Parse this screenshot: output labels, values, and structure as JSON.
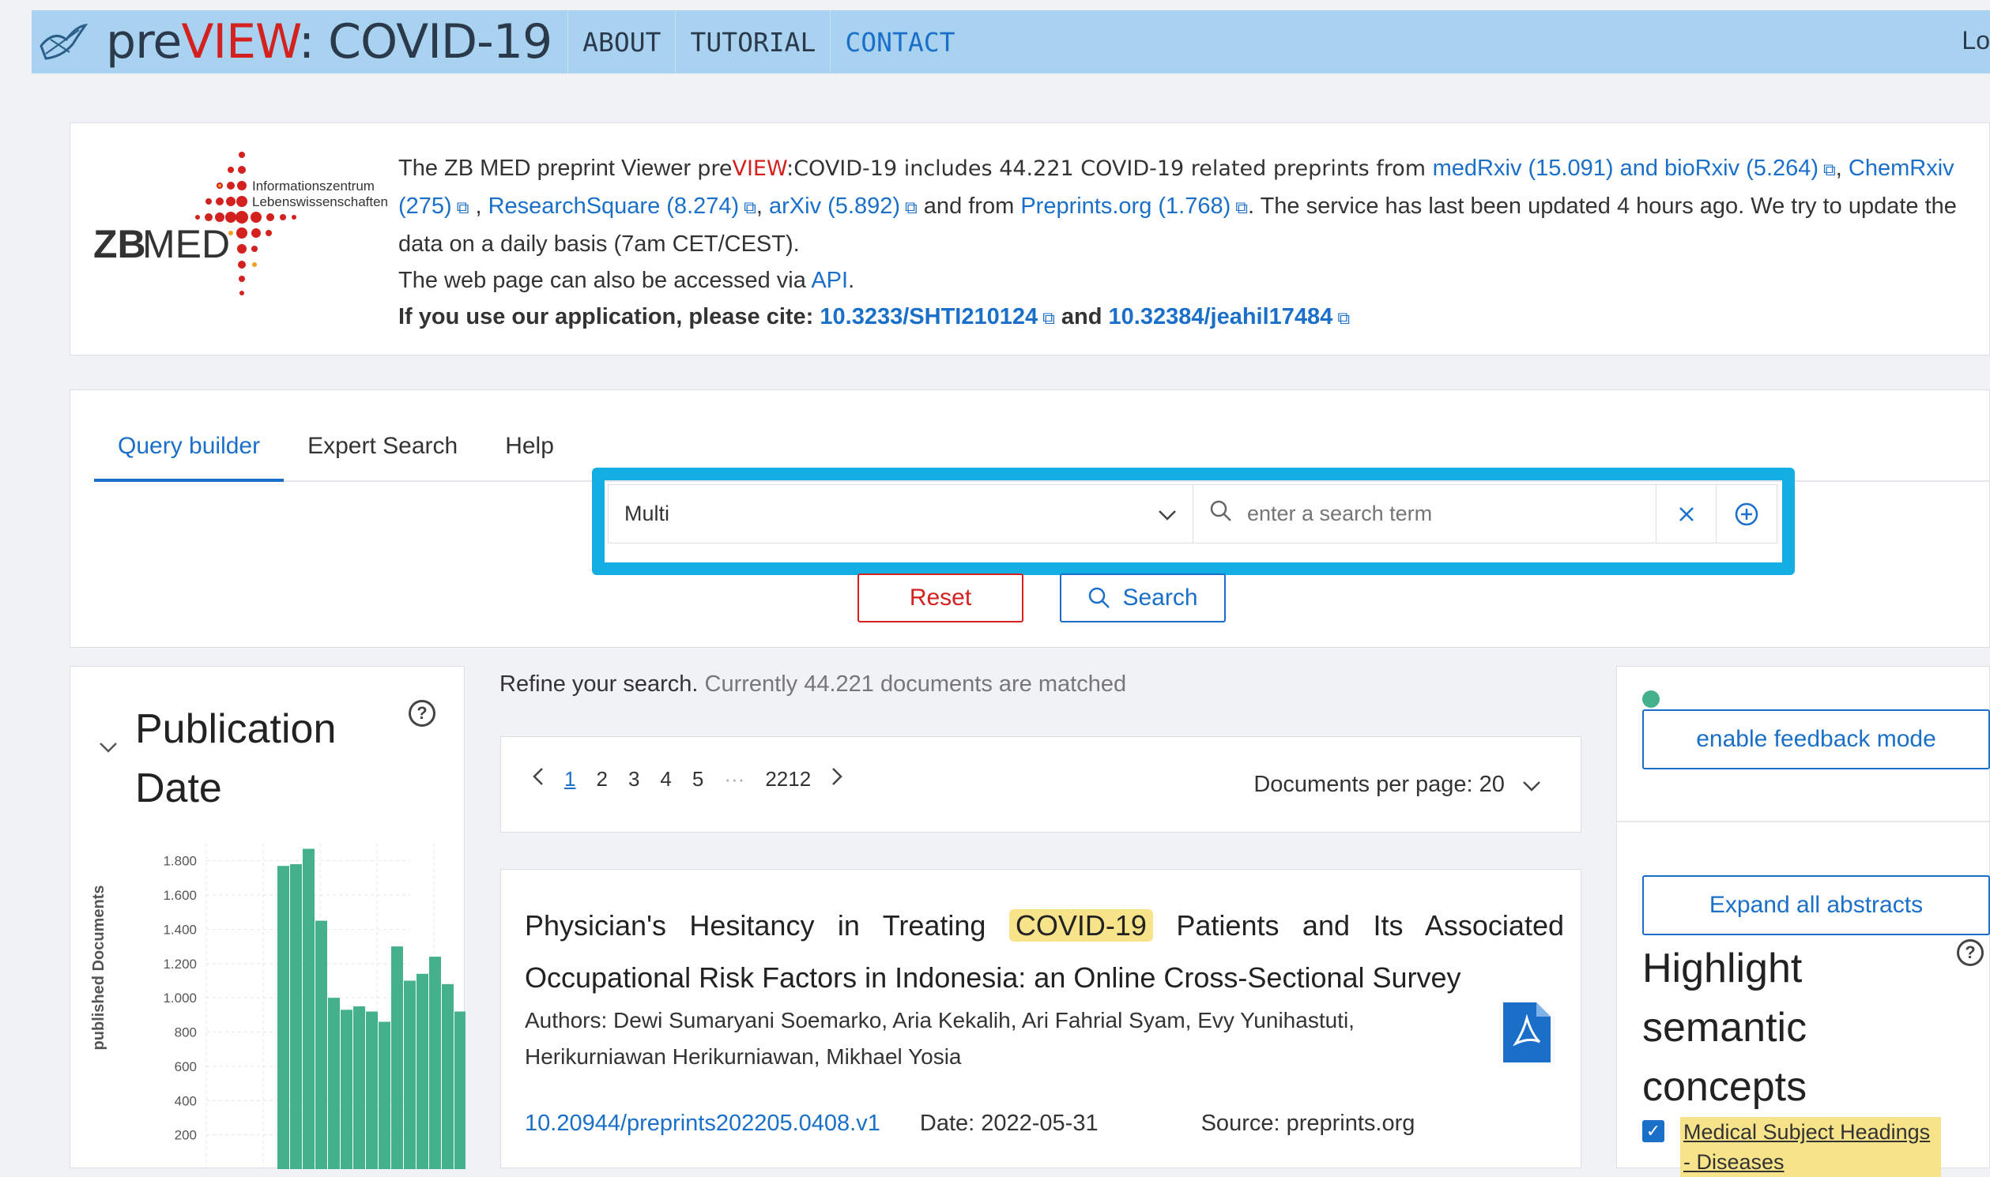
{
  "header": {
    "title_prefix": "pre",
    "title_red": "VIEW",
    "title_suffix": ": COVID-19",
    "nav": [
      "ABOUT",
      "TUTORIAL",
      "CONTACT"
    ],
    "login": "Lo"
  },
  "logo": {
    "line1": "Informationszentrum",
    "line2": "Lebenswissenschaften",
    "zb": "ZB",
    "med": "MED"
  },
  "info": {
    "p1_a": "The ZB MED preprint Viewer ",
    "p1_pre": "pre",
    "p1_view": "VIEW",
    "p1_b": ":COVID-19 includes 44.221 COVID-19 related preprints from ",
    "link_med_bio": "medRxiv (15.091) and bioRxiv (5.264)",
    "link_chem": "ChemRxiv (275)",
    "link_rs": "ResearchSquare (8.274)",
    "link_arxiv": "arXiv (5.892)",
    "and_from": " and from ",
    "link_preprints": "Preprints.org (1.768)",
    "p1_end": ". The service has last been updated 4 hours ago. We try to update the data on a daily basis (7am CET/CEST).",
    "p2": "The web page can also be accessed via ",
    "api": "API",
    "p3": "If you use our application, please cite: ",
    "cite1": "10.3233/SHTI210124",
    "and": " and ",
    "cite2": "10.32384/jeahil17484"
  },
  "search": {
    "tabs": [
      "Query builder",
      "Expert Search",
      "Help"
    ],
    "field_select": "Multi",
    "placeholder": "enter a search term",
    "reset_label": "Reset",
    "search_label": "Search"
  },
  "filter": {
    "title": "Publication Date",
    "chart_ylabel": "published Documents"
  },
  "chart_data": {
    "type": "bar",
    "ylabel": "published Documents",
    "yticks": [
      "200",
      "400",
      "600",
      "800",
      "1.000",
      "1.200",
      "1.400",
      "1.600",
      "1.800"
    ],
    "ylim": [
      0,
      1900
    ],
    "values": [
      1770,
      1780,
      1870,
      1450,
      1000,
      930,
      950,
      920,
      860,
      1300,
      1100,
      1140,
      1240,
      1080,
      920
    ]
  },
  "results": {
    "refine_label": "Refine your search.",
    "matched": " Currently 44.221 documents are matched",
    "pages": [
      "1",
      "2",
      "3",
      "4",
      "5",
      "···",
      "2212"
    ],
    "per_page": "Documents per page: 20",
    "item": {
      "title_a": "Physician's Hesitancy in Treating ",
      "title_hl": "COVID-19",
      "title_b": " Patients and Its Associated Occupational Risk Factors in Indonesia: an Online Cross-Sectional Survey",
      "authors": "Authors: Dewi Sumaryani Soemarko, Aria Kekalih, Ari Fahrial Syam, Evy Yunihastuti, Herikurniawan Herikurniawan, Mikhael Yosia",
      "doi": "10.20944/preprints202205.0408.v1",
      "date": "Date: 2022-05-31",
      "source": "Source: preprints.org"
    }
  },
  "sidebar": {
    "feedback": "enable feedback mode",
    "expand": "Expand all abstracts",
    "highlight_title": "Highlight semantic concepts",
    "concept": "Medical Subject Headings - Diseases"
  },
  "colors": {
    "accent": "#1a6fc9",
    "brand_red": "#d3211f",
    "header_bg": "#a9d1f0",
    "bar": "#45b08c",
    "highlight": "#f7e38a",
    "focus_box": "#15aee3"
  }
}
